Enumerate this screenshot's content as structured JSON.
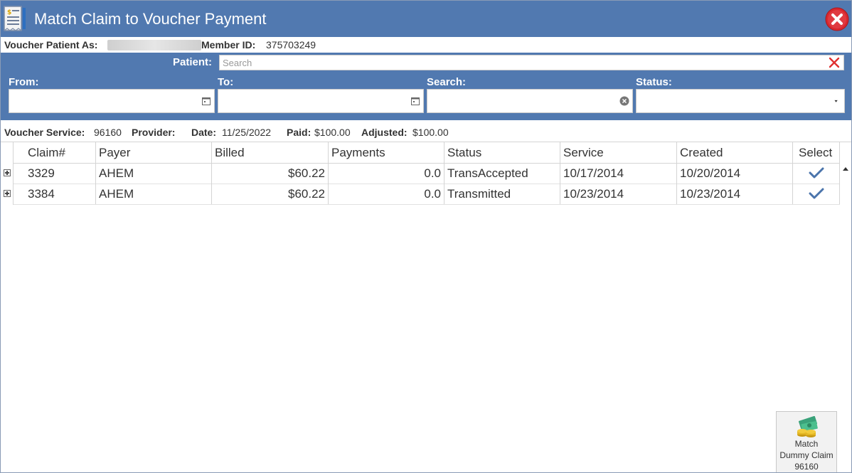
{
  "window": {
    "title": "Match Claim to Voucher Payment"
  },
  "info": {
    "voucher_patient_label": "Voucher Patient As:",
    "member_id_label": "Member ID:",
    "member_id": "375703249"
  },
  "filters": {
    "patient_label": "Patient:",
    "patient_placeholder": "Search",
    "from_label": "From:",
    "to_label": "To:",
    "search_label": "Search:",
    "status_label": "Status:"
  },
  "voucher": {
    "service_label": "Voucher Service:",
    "service": "96160",
    "provider_label": "Provider:",
    "date_label": "Date:",
    "date": "11/25/2022",
    "paid_label": "Paid:",
    "paid": "$100.00",
    "adjusted_label": "Adjusted:",
    "adjusted": "$100.00"
  },
  "grid": {
    "columns": [
      "Claim#",
      "Payer",
      "Billed",
      "Payments",
      "Status",
      "Service",
      "Created",
      "Select"
    ],
    "rows": [
      {
        "claim": "3329",
        "payer": "AHEM",
        "billed": "$60.22",
        "payments": "0.0",
        "status": "TransAccepted",
        "service": "10/17/2014",
        "created": "10/20/2014"
      },
      {
        "claim": "3384",
        "payer": "AHEM",
        "billed": "$60.22",
        "payments": "0.0",
        "status": "Transmitted",
        "service": "10/23/2014",
        "created": "10/23/2014"
      }
    ]
  },
  "actions": {
    "match_line1": "Match",
    "match_line2": "Dummy Claim",
    "match_line3": "96160"
  },
  "colors": {
    "header_blue": "#5179b0",
    "check_blue": "#4a74ab",
    "close_red": "#d9272e"
  }
}
